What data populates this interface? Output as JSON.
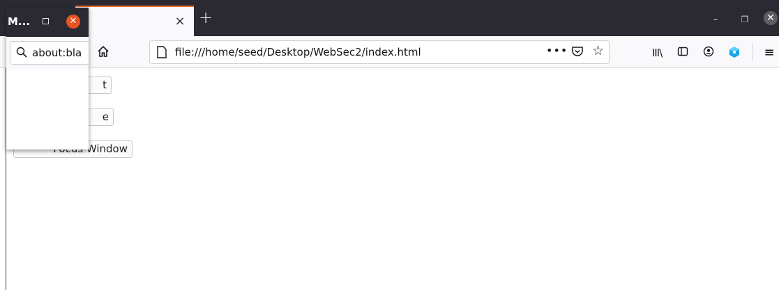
{
  "browser": {
    "tab": {
      "close_glyph": "×"
    },
    "new_tab_glyph": "+",
    "window_controls": {
      "minimize": "–",
      "maximize": "❐",
      "close": "✕"
    },
    "url": "file:///home/seed/Desktop/WebSec2/index.html",
    "url_actions": {
      "more": "•••"
    },
    "toolbar": {
      "library": "III\\",
      "menu": "≡"
    },
    "icons": [
      "home-icon",
      "page-icon",
      "more-icon",
      "pocket-icon",
      "bookmark-star-icon",
      "library-icon",
      "sidebar-icon",
      "account-icon",
      "extension-icon",
      "menu-icon"
    ]
  },
  "page": {
    "buttons": [
      {
        "visible_label": "t"
      },
      {
        "visible_label": "e"
      },
      {
        "visible_label": "Focus Window"
      }
    ]
  },
  "popup": {
    "title": "M...",
    "url_text": "about:bla",
    "close_color": "#e95420"
  },
  "colors": {
    "chrome_dark": "#2b2a33",
    "toolbar_bg": "#f9f9fb",
    "active_tab_accent": "#e66a2c",
    "extension_accent": "#1fa3e5"
  }
}
